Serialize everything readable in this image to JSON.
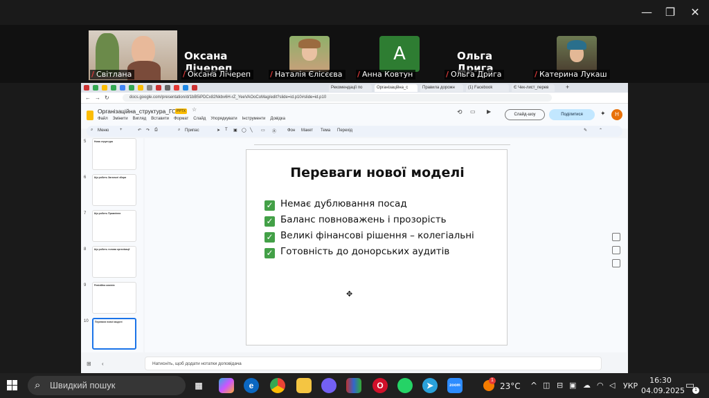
{
  "window": {
    "minimize": "—",
    "restore": "❐",
    "close": "✕"
  },
  "participants": [
    {
      "label": "Світлана",
      "muted": true
    },
    {
      "big_name": "Оксана Лічереп",
      "label": "Оксана Лічереп",
      "muted": true
    },
    {
      "label": "Наталія Єлісєєва",
      "muted": true
    },
    {
      "avatar_letter": "A",
      "label": "Анна Ковтун",
      "muted": true
    },
    {
      "big_name": "Ольга Дрига",
      "label": "Ольга Дрига",
      "muted": true
    },
    {
      "label": "Катерина Лукаш",
      "muted": true
    }
  ],
  "browser": {
    "tabs": [
      "Рекомендації по",
      "Організаційна_с",
      "Правила дорожн",
      "(1) Facebook",
      "Є Чек-лист_перев"
    ],
    "url": "docs.google.com/presentation/d/1bB5iPDCx82Nkbv6H-rZ_YeeVAOoCoMag/edit?slide=id.p10#slide=id.p10",
    "new_tab": "+"
  },
  "docs": {
    "file_name": "Організаційна_структура_ГО-1",
    "file_badge": "PPTX",
    "menus": [
      "Файл",
      "Змінити",
      "Вигляд",
      "Вставити",
      "Формат",
      "Слайд",
      "Упорядкувати",
      "Інструменти",
      "Довідка"
    ],
    "slideshow_button": "Слайд-шоу",
    "share_button": "Поділитися",
    "avatar_letter": "Н",
    "toolbar": {
      "menu_search": "Меню",
      "fit": "Припас",
      "background": "Фон",
      "layout": "Макет",
      "theme": "Тема",
      "transition": "Перехід"
    },
    "notes_placeholder": "Натисніть, щоб додати нотатки доповідача"
  },
  "thumbnails": [
    {
      "num": "5",
      "title": "Нова структура"
    },
    {
      "num": "6",
      "title": "Що робить Загальні збори"
    },
    {
      "num": "7",
      "title": "Що робить Правління"
    },
    {
      "num": "8",
      "title": "Що робить голова організації"
    },
    {
      "num": "9",
      "title": "Ревізійна комісія"
    },
    {
      "num": "10",
      "title": "Переваги нової моделі"
    }
  ],
  "slide": {
    "title": "Переваги нової моделі",
    "bullets": [
      "Немає дублювання посад",
      "Баланс повноважень і прозорість",
      "Великі фінансові рішення – колегіальні",
      "Готовність до донорських аудитів"
    ],
    "check_glyph": "✓"
  },
  "taskbar": {
    "search_placeholder": "Швидкий пошук",
    "weather": "23°C",
    "weather_badge": "1",
    "language": "УКР",
    "time": "16:30",
    "date": "04.09.2025",
    "notification_count": "1"
  },
  "colors": {
    "share": "#c2e7ff",
    "check": "#43a047",
    "avatar": "#e8710a",
    "zoom": "#2d8cff"
  }
}
